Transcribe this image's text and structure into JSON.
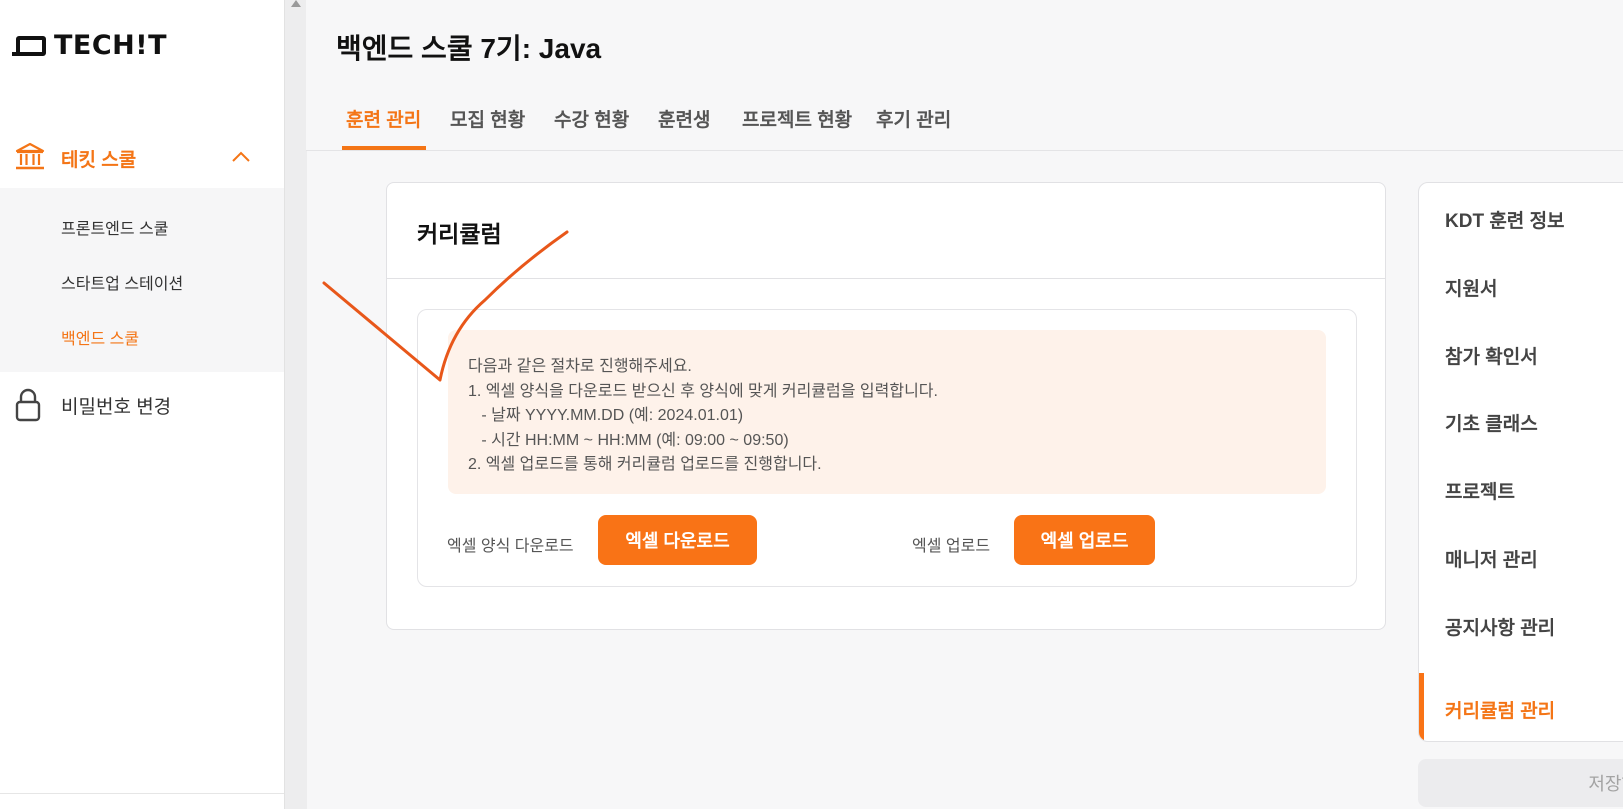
{
  "brand": {
    "logo_text": "TECH!T"
  },
  "sidebar": {
    "group": {
      "label": "테킷 스쿨",
      "icon": "bank-icon",
      "expanded": true
    },
    "sub_items": [
      {
        "label": "프론트엔드 스쿨",
        "active": false
      },
      {
        "label": "스타트업 스테이션",
        "active": false
      },
      {
        "label": "백엔드 스쿨",
        "active": true
      }
    ],
    "password": {
      "label": "비밀번호 변경",
      "icon": "lock-icon"
    }
  },
  "header": {
    "title": "백엔드 스쿨 7기: Java",
    "tabs": [
      {
        "label": "훈련 관리",
        "active": true
      },
      {
        "label": "모집 현황",
        "active": false
      },
      {
        "label": "수강 현황",
        "active": false
      },
      {
        "label": "훈련생",
        "active": false
      },
      {
        "label": "프로젝트 현황",
        "active": false
      },
      {
        "label": "후기 관리",
        "active": false
      }
    ]
  },
  "curriculum": {
    "title": "커리큘럼",
    "notice_lines": [
      "다음과 같은 절차로 진행해주세요.",
      "1. 엑셀 양식을 다운로드 받으신 후 양식에 맞게 커리큘럼을 입력합니다.",
      "   - 날짜 YYYY.MM.DD (예: 2024.01.01)",
      "   - 시간 HH:MM ~ HH:MM (예: 09:00 ~ 09:50)",
      "2. 엑셀 업로드를 통해 커리큘럼 업로드를 진행합니다."
    ],
    "download_label": "엑셀 양식 다운로드",
    "download_button": "엑셀 다운로드",
    "upload_label": "엑셀 업로드",
    "upload_button": "엑셀 업로드"
  },
  "right_panel": {
    "items": [
      {
        "label": "KDT 훈련 정보",
        "active": false
      },
      {
        "label": "지원서",
        "active": false
      },
      {
        "label": "참가 확인서",
        "active": false
      },
      {
        "label": "기초 클래스",
        "active": false
      },
      {
        "label": "프로젝트",
        "active": false
      },
      {
        "label": "매니저 관리",
        "active": false
      },
      {
        "label": "공지사항 관리",
        "active": false
      },
      {
        "label": "커리큘럼 관리",
        "active": true
      }
    ],
    "save_button": "저장하"
  },
  "colors": {
    "accent": "#f97316",
    "notice_bg": "#fef2ea",
    "annotation": "#e8571a"
  }
}
